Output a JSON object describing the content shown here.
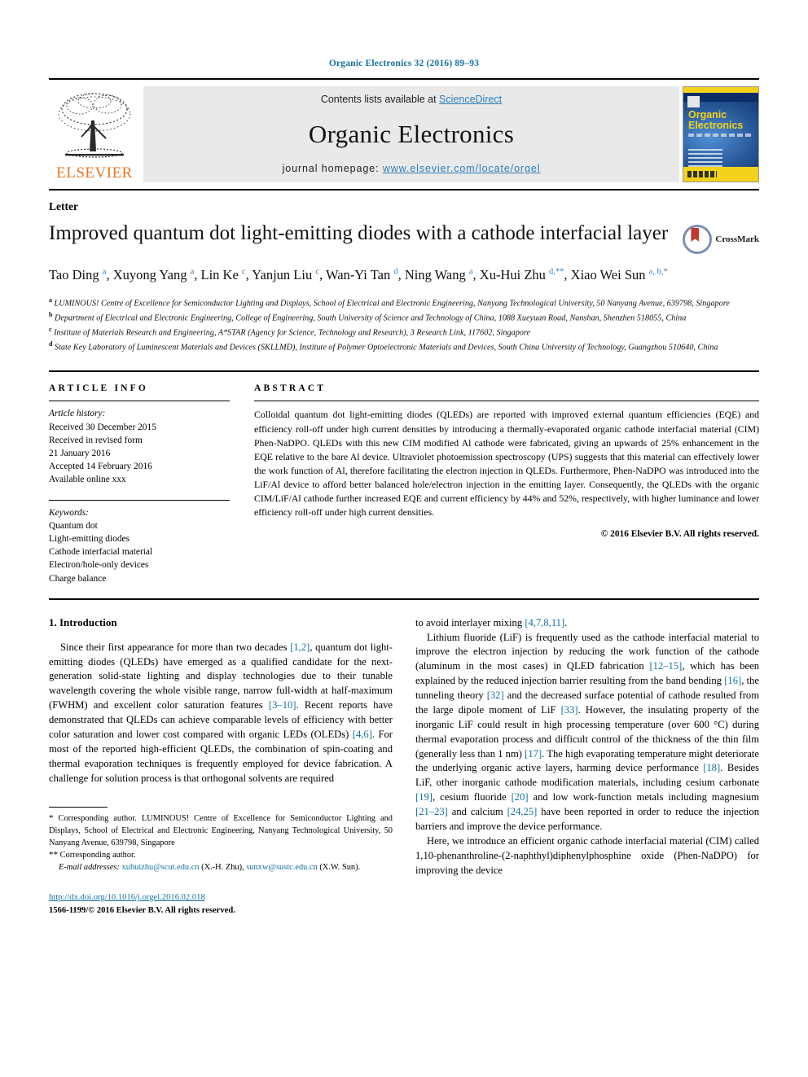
{
  "running_head": "Organic Electronics 32 (2016) 89–93",
  "masthead": {
    "contents_prefix": "Contents lists available at ",
    "sciencedirect": "ScienceDirect",
    "journal_name": "Organic Electronics",
    "homepage_prefix": "journal homepage: ",
    "homepage_url": "www.elsevier.com/locate/orgel",
    "publisher": "ELSEVIER",
    "cover": {
      "line1": "Organic",
      "line2": "Electronics"
    }
  },
  "article": {
    "type_label": "Letter",
    "title": "Improved quantum dot light-emitting diodes with a cathode interfacial layer",
    "crossmark_label": "CrossMark",
    "authors_html": "Tao Ding <sup>a</sup>, Xuyong Yang <sup>a</sup>, Lin Ke <sup>c</sup>, Yanjun Liu <sup>c</sup>, Wan-Yi Tan <sup>d</sup>, Ning Wang <sup>a</sup>, Xu-Hui Zhu <sup>d,&#42;&#42;</sup>, Xiao Wei Sun <sup>a, b,&#42;</sup>",
    "affiliations": [
      "<sup>a</sup> LUMINOUS! Centre of Excellence for Semiconductor Lighting and Displays, School of Electrical and Electronic Engineering, Nanyang Technological University, 50 Nanyang Avenue, 639798, Singapore",
      "<sup>b</sup> Department of Electrical and Electronic Engineering, College of Engineering, South University of Science and Technology of China, 1088 Xueyuan Road, Nanshan, Shenzhen 518055, China",
      "<sup>c</sup> Institute of Materials Research and Engineering, A*STAR (Agency for Science, Technology and Research), 3 Research Link, 117602, Singapore",
      "<sup>d</sup> State Key Laboratory of Luminescent Materials and Devices (SKLLMD), Institute of Polymer Optoelectronic Materials and Devices, South China University of Technology, Guangzhou 510640, China"
    ]
  },
  "article_info": {
    "heading": "ARTICLE INFO",
    "history_label": "Article history:",
    "history": [
      "Received 30 December 2015",
      "Received in revised form",
      "21 January 2016",
      "Accepted 14 February 2016",
      "Available online xxx"
    ],
    "keywords_label": "Keywords:",
    "keywords": [
      "Quantum dot",
      "Light-emitting diodes",
      "Cathode interfacial material",
      "Electron/hole-only devices",
      "Charge balance"
    ]
  },
  "abstract": {
    "heading": "ABSTRACT",
    "text": "Colloidal quantum dot light-emitting diodes (QLEDs) are reported with improved external quantum efficiencies (EQE) and efficiency roll-off under high current densities by introducing a thermally-evaporated organic cathode interfacial material (CIM) Phen-NaDPO. QLEDs with this new CIM modified Al cathode were fabricated, giving an upwards of 25% enhancement in the EQE relative to the bare Al device. Ultraviolet photoemission spectroscopy (UPS) suggests that this material can effectively lower the work function of Al, therefore facilitating the electron injection in QLEDs. Furthermore, Phen-NaDPO was introduced into the LiF/Al device to afford better balanced hole/electron injection in the emitting layer. Consequently, the QLEDs with the organic CIM/LiF/Al cathode further increased EQE and current efficiency by 44% and 52%, respectively, with higher luminance and lower efficiency roll-off under high current densities.",
    "copyright": "© 2016 Elsevier B.V. All rights reserved."
  },
  "body": {
    "section_heading": "1. Introduction",
    "left_paragraphs": [
      "Since their first appearance for more than two decades <span class=\"ref\">[1,2]</span>, quantum dot light-emitting diodes (QLEDs) have emerged as a qualified candidate for the next-generation solid-state lighting and display technologies due to their tunable wavelength covering the whole visible range, narrow full-width at half-maximum (FWHM) and excellent color saturation features <span class=\"ref\">[3–10]</span>. Recent reports have demonstrated that QLEDs can achieve comparable levels of efficiency with better color saturation and lower cost compared with organic LEDs (OLEDs) <span class=\"ref\">[4,6]</span>. For most of the reported high-efficient QLEDs, the combination of spin-coating and thermal evaporation techniques is frequently employed for device fabrication. A challenge for solution process is that orthogonal solvents are required"
    ],
    "right_paragraphs": [
      "to avoid interlayer mixing <span class=\"ref\">[4,7,8,11]</span>.",
      "Lithium fluoride (LiF) is frequently used as the cathode interfacial material to improve the electron injection by reducing the work function of the cathode (aluminum in the most cases) in QLED fabrication <span class=\"ref\">[12–15]</span>, which has been explained by the reduced injection barrier resulting from the band bending <span class=\"ref\">[16]</span>, the tunneling theory <span class=\"ref\">[32]</span> and the decreased surface potential of cathode resulted from the large dipole moment of LiF <span class=\"ref\">[33]</span>. However, the insulating property of the inorganic LiF could result in high processing temperature (over 600 °C) during thermal evaporation process and difficult control of the thickness of the thin film (generally less than 1 nm) <span class=\"ref\">[17]</span>. The high evaporating temperature might deteriorate the underlying organic active layers, harming device performance <span class=\"ref\">[18]</span>. Besides LiF, other inorganic cathode modification materials, including cesium carbonate <span class=\"ref\">[19]</span>, cesium fluoride <span class=\"ref\">[20]</span> and low work-function metals including magnesium <span class=\"ref\">[21–23]</span> and calcium <span class=\"ref\">[24,25]</span> have been reported in order to reduce the injection barriers and improve the device performance.",
      "Here, we introduce an efficient organic cathode interfacial material (CIM) called 1,10-phenanthroline-(2-naphthyl)diphenylphosphine oxide (Phen-NaDPO) for improving the device"
    ]
  },
  "footnotes": {
    "corresponding_1": "<span style=\"font-size:11px\">&#42;</span> Corresponding author. LUMINOUS! Centre of Excellence for Semiconductor Lighting and Displays, School of Electrical and Electronic Engineering, Nanyang Technological University, 50 Nanyang Avenue, 639798, Singapore",
    "corresponding_2": "<span style=\"font-size:11px\">&#42;&#42;</span> Corresponding author.",
    "email_line": "<span class=\"it\">E-mail addresses:</span> <span class=\"mail\">xuhuizhu@scut.edu.cn</span> (X.-H. Zhu), <span class=\"mail\">sunxw@sustc.edu.cn</span> (X.W. Sun)."
  },
  "publication_footer": {
    "doi_url": "http://dx.doi.org/10.1016/j.orgel.2016.02.018",
    "issn_line": "1566-1199/© 2016 Elsevier B.V. All rights reserved."
  }
}
